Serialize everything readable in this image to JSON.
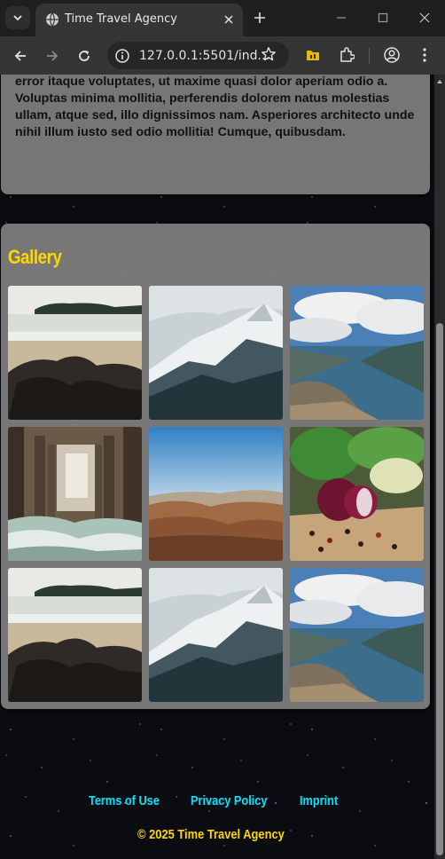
{
  "browser": {
    "tab_title": "Time Travel Agency",
    "url": "127.0.0.1:5501/ind...",
    "icons": [
      "tab-search-icon",
      "globe-icon",
      "close-icon",
      "plus-icon",
      "minimize-icon",
      "maximize-icon",
      "window-close-icon",
      "back-arrow-icon",
      "forward-arrow-icon",
      "reload-icon",
      "site-info-icon",
      "bookmark-star-icon",
      "folder-extension-icon",
      "extensions-puzzle-icon",
      "profile-icon",
      "kebab-menu-icon"
    ]
  },
  "about": {
    "text": "maiores perspiciatis labore iste eos facilis libero asperiores odit error itaque voluptates, ut maxime quasi dolor aperiam odio a. Voluptas minima mollitia, perferendis dolorem natus molestias ullam, atque sed, illo dignissimos nam. Asperiores architecto unde nihil illum iusto sed odio mollitia! Cumque, quibusdam."
  },
  "gallery": {
    "title": "Gallery",
    "images": [
      {
        "subject": "rocky beach"
      },
      {
        "subject": "snowy mountain"
      },
      {
        "subject": "fjord with clouds"
      },
      {
        "subject": "under the pier"
      },
      {
        "subject": "desert hills"
      },
      {
        "subject": "red onion and peppercorns"
      },
      {
        "subject": "rocky beach"
      },
      {
        "subject": "snowy mountain"
      },
      {
        "subject": "fjord with clouds"
      }
    ]
  },
  "footer": {
    "links": [
      "Terms of Use",
      "Privacy Policy",
      "Imprint"
    ],
    "copyright": "© 2025 Time Travel Agency"
  },
  "colors": {
    "gallery_title": "#ffd700",
    "footer_link": "#00e5ff",
    "copyright": "#ffd700",
    "card_bg": "#808080",
    "page_bg": "#0a0c11"
  }
}
